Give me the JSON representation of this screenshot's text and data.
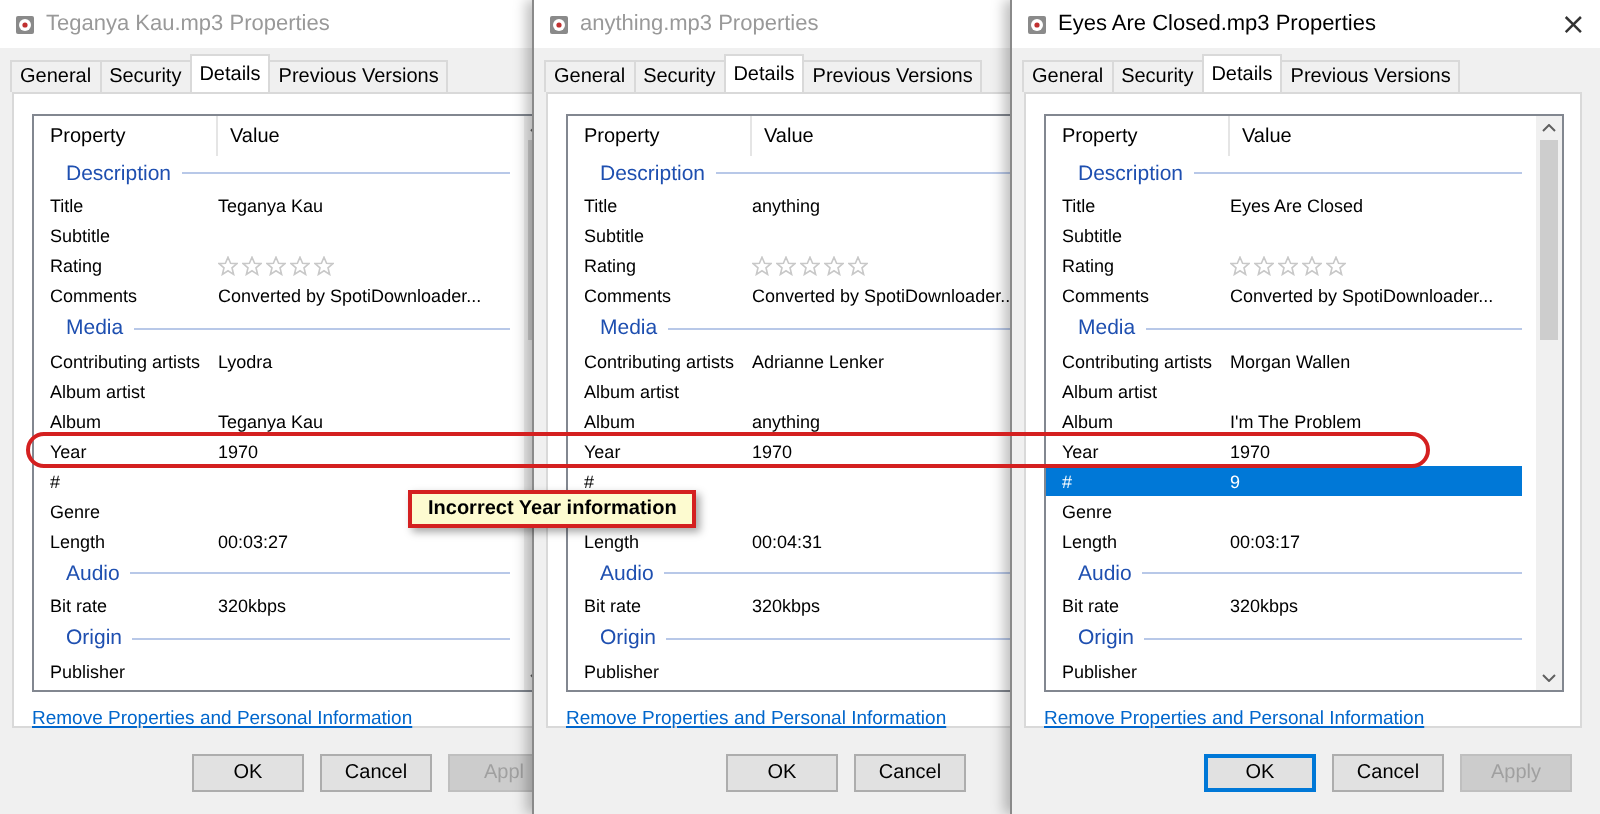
{
  "windows": [
    {
      "title": "Teganya Kau.mp3 Properties",
      "active": false,
      "tabs": [
        {
          "label": "General",
          "selected": false
        },
        {
          "label": "Security",
          "selected": false
        },
        {
          "label": "Details",
          "selected": true
        },
        {
          "label": "Previous Versions",
          "selected": false
        }
      ],
      "columns": [
        "Property",
        "Value"
      ],
      "rows": [
        {
          "kind": "group",
          "label": "Description"
        },
        {
          "kind": "property",
          "label": "Title",
          "value": "Teganya Kau",
          "selected": false
        },
        {
          "kind": "property",
          "label": "Subtitle",
          "selected": false
        },
        {
          "kind": "rating",
          "label": "Rating",
          "stars": 0,
          "selected": false
        },
        {
          "kind": "property",
          "label": "Comments",
          "value": "Converted by SpotiDownloader...",
          "selected": false
        },
        {
          "kind": "group",
          "label": "Media"
        },
        {
          "kind": "property",
          "label": "Contributing artists",
          "value": "Lyodra",
          "selected": false
        },
        {
          "kind": "property",
          "label": "Album artist",
          "selected": false
        },
        {
          "kind": "property",
          "label": "Album",
          "value": "Teganya Kau",
          "selected": false
        },
        {
          "kind": "property",
          "label": "Year",
          "value": "1970",
          "selected": false
        },
        {
          "kind": "property",
          "label": "#",
          "selected": false
        },
        {
          "kind": "property",
          "label": "Genre",
          "selected": false
        },
        {
          "kind": "property",
          "label": "Length",
          "value": "00:03:27",
          "selected": false
        },
        {
          "kind": "group",
          "label": "Audio"
        },
        {
          "kind": "property",
          "label": "Bit rate",
          "value": "320kbps",
          "selected": false
        },
        {
          "kind": "group",
          "label": "Origin"
        },
        {
          "kind": "property",
          "label": "Publisher",
          "selected": false
        }
      ],
      "link": "Remove Properties and Personal Information",
      "buttons": [
        {
          "label": "OK",
          "focused": false,
          "disabled": false
        },
        {
          "label": "Cancel",
          "focused": false,
          "disabled": false
        },
        {
          "label": "Appl",
          "focused": false,
          "disabled": true
        }
      ]
    },
    {
      "title": "anything.mp3 Properties",
      "active": false,
      "tabs": [
        {
          "label": "General",
          "selected": false
        },
        {
          "label": "Security",
          "selected": false
        },
        {
          "label": "Details",
          "selected": true
        },
        {
          "label": "Previous Versions",
          "selected": false
        }
      ],
      "columns": [
        "Property",
        "Value"
      ],
      "rows": [
        {
          "kind": "group",
          "label": "Description"
        },
        {
          "kind": "property",
          "label": "Title",
          "value": "anything",
          "selected": false
        },
        {
          "kind": "property",
          "label": "Subtitle",
          "selected": false
        },
        {
          "kind": "rating",
          "label": "Rating",
          "stars": 0,
          "selected": false
        },
        {
          "kind": "property",
          "label": "Comments",
          "value": "Converted by SpotiDownloader..",
          "selected": false
        },
        {
          "kind": "group",
          "label": "Media"
        },
        {
          "kind": "property",
          "label": "Contributing artists",
          "value": "Adrianne Lenker",
          "selected": false
        },
        {
          "kind": "property",
          "label": "Album artist",
          "selected": false
        },
        {
          "kind": "property",
          "label": "Album",
          "value": "anything",
          "selected": false
        },
        {
          "kind": "property",
          "label": "Year",
          "value": "1970",
          "selected": false
        },
        {
          "kind": "property",
          "label": "#",
          "selected": false
        },
        {
          "kind": "property",
          "selected": false
        },
        {
          "kind": "property",
          "label": "Length",
          "value": "00:04:31",
          "selected": false
        },
        {
          "kind": "group",
          "label": "Audio"
        },
        {
          "kind": "property",
          "label": "Bit rate",
          "value": "320kbps",
          "selected": false
        },
        {
          "kind": "group",
          "label": "Origin"
        },
        {
          "kind": "property",
          "label": "Publisher",
          "selected": false
        }
      ],
      "link": "Remove Properties and Personal Information",
      "buttons": [
        {
          "label": "OK",
          "focused": false,
          "disabled": false
        },
        {
          "label": "Cancel",
          "focused": false,
          "disabled": false
        }
      ]
    },
    {
      "title": "Eyes Are Closed.mp3 Properties",
      "active": true,
      "close": "×",
      "tabs": [
        {
          "label": "General",
          "selected": false
        },
        {
          "label": "Security",
          "selected": false
        },
        {
          "label": "Details",
          "selected": true
        },
        {
          "label": "Previous Versions",
          "selected": false
        }
      ],
      "columns": [
        "Property",
        "Value"
      ],
      "rows": [
        {
          "kind": "group",
          "label": "Description"
        },
        {
          "kind": "property",
          "label": "Title",
          "value": "Eyes Are Closed",
          "selected": false
        },
        {
          "kind": "property",
          "label": "Subtitle",
          "selected": false
        },
        {
          "kind": "rating",
          "label": "Rating",
          "stars": 0,
          "selected": false
        },
        {
          "kind": "property",
          "label": "Comments",
          "value": "Converted by SpotiDownloader...",
          "selected": false
        },
        {
          "kind": "group",
          "label": "Media"
        },
        {
          "kind": "property",
          "label": "Contributing artists",
          "value": "Morgan Wallen",
          "selected": false
        },
        {
          "kind": "property",
          "label": "Album artist",
          "selected": false
        },
        {
          "kind": "property",
          "label": "Album",
          "value": "I'm The Problem",
          "selected": false
        },
        {
          "kind": "property",
          "label": "Year",
          "value": "1970",
          "selected": false
        },
        {
          "kind": "property",
          "label": "#",
          "value": "9",
          "selected": true
        },
        {
          "kind": "property",
          "label": "Genre",
          "selected": false
        },
        {
          "kind": "property",
          "label": "Length",
          "value": "00:03:17",
          "selected": false
        },
        {
          "kind": "group",
          "label": "Audio"
        },
        {
          "kind": "property",
          "label": "Bit rate",
          "value": "320kbps",
          "selected": false
        },
        {
          "kind": "group",
          "label": "Origin"
        },
        {
          "kind": "property",
          "label": "Publisher",
          "selected": false
        }
      ],
      "link": "Remove Properties and Personal Information",
      "buttons": [
        {
          "label": "OK",
          "focused": true,
          "disabled": false
        },
        {
          "label": "Cancel",
          "focused": false,
          "disabled": false
        },
        {
          "label": "Apply",
          "focused": false,
          "disabled": true
        }
      ]
    }
  ],
  "callout": "Incorrect Year information"
}
